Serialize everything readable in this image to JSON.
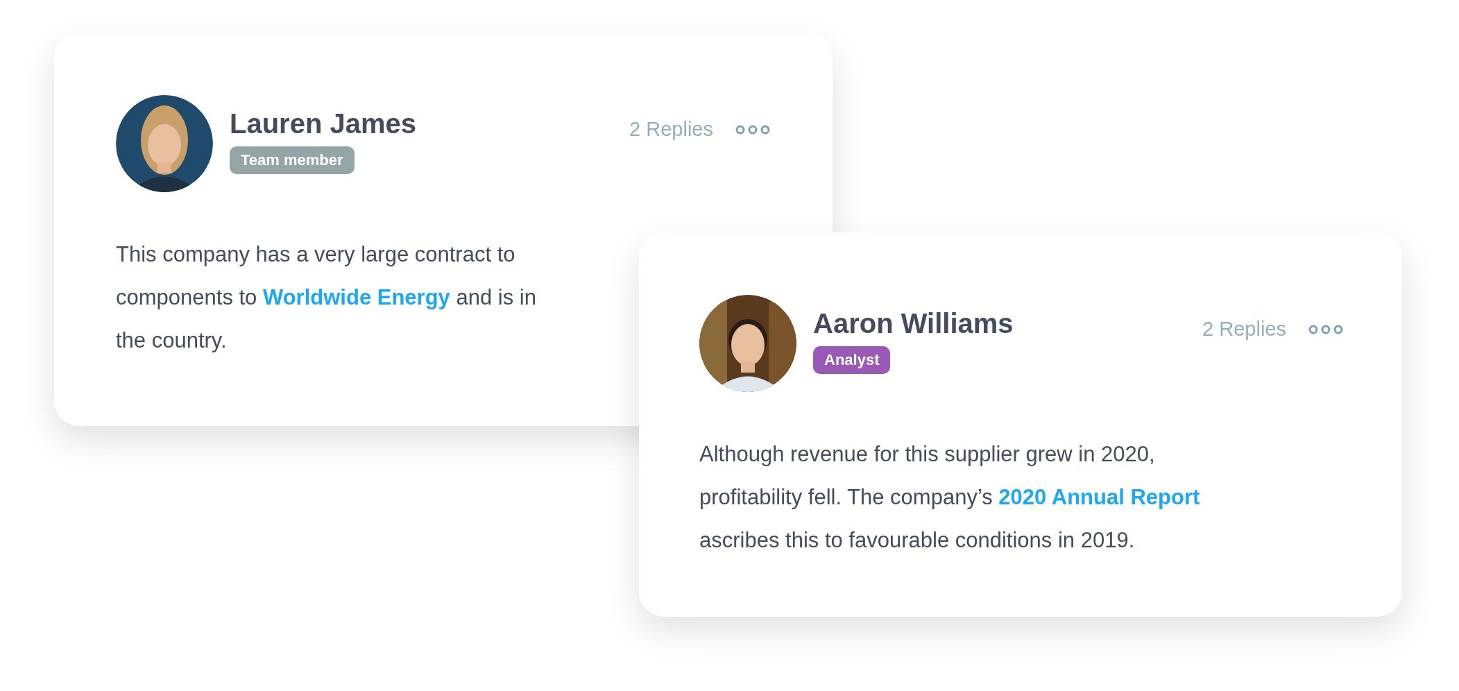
{
  "comments": [
    {
      "author": "Lauren James",
      "role": {
        "label": "Team member",
        "color": "#95a5a6"
      },
      "replies": "2 Replies",
      "avatar": {
        "kind": "picture"
      },
      "body_lines": [
        [
          {
            "text": "This company has a very large contract to",
            "link": false
          }
        ],
        [
          {
            "text": "components to ",
            "link": false
          },
          {
            "text": "Worldwide Energy",
            "link": true
          },
          {
            "text": " and is in",
            "link": false
          }
        ],
        [
          {
            "text": "the country.",
            "link": false
          }
        ]
      ]
    },
    {
      "author": "Aaron Williams",
      "role": {
        "label": "Analyst",
        "color": "#9b59b6"
      },
      "replies": "2 Replies",
      "avatar": {
        "kind": "picture"
      },
      "body_lines": [
        [
          {
            "text": "Although revenue for this supplier grew in 2020,",
            "link": false
          }
        ],
        [
          {
            "text": "profitability fell. The company’s ",
            "link": false
          },
          {
            "text": "2020 Annual Report",
            "link": true
          }
        ],
        [
          {
            "text": "ascribes this to favourable conditions in 2019.",
            "link": false
          }
        ]
      ]
    }
  ]
}
